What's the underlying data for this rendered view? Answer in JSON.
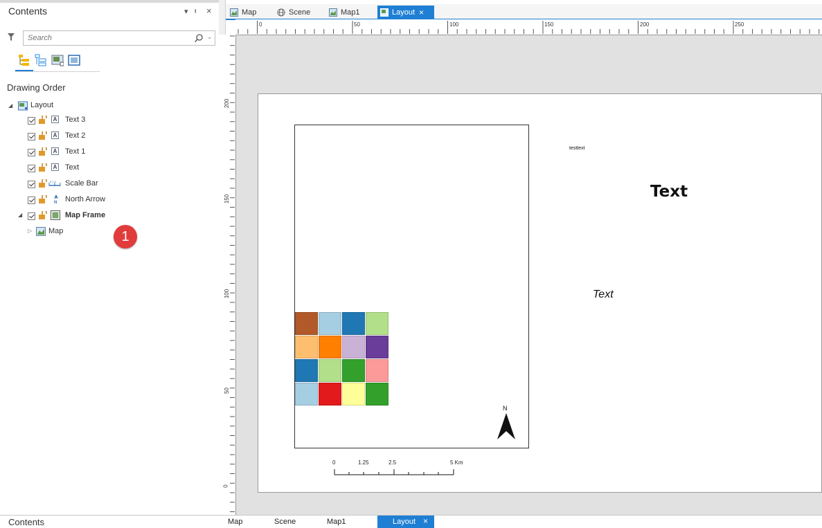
{
  "contents_pane": {
    "title": "Contents",
    "controls": [
      "▾",
      "ᵼ",
      "×"
    ],
    "search_placeholder": "Search",
    "section_title": "Drawing Order",
    "tree": {
      "root": "Layout",
      "items": [
        "Text 3",
        "Text 2",
        "Text 1",
        "Text",
        "Scale Bar",
        "North Arrow"
      ],
      "map_frame": "Map Frame",
      "map": "Map"
    }
  },
  "tabs": [
    {
      "label": "Map"
    },
    {
      "label": "Scene"
    },
    {
      "label": "Map1"
    },
    {
      "label": "Layout",
      "close": "×"
    }
  ],
  "ruler": {
    "horizontal": [
      "0",
      "50",
      "100",
      "150",
      "200",
      "250"
    ],
    "vertical": [
      "200",
      "150",
      "100",
      "50",
      "0"
    ]
  },
  "layout": {
    "small_text": "testtext",
    "big_text": "Text",
    "italic_text": "Text",
    "north_label": "N",
    "scale_labels": [
      "0",
      "1.25",
      "2.5",
      "5 Km"
    ],
    "grid_colors": [
      [
        "#b15928",
        "#a6cee3",
        "#1f78b4",
        "#b2df8a"
      ],
      [
        "#fdbf6f",
        "#ff7f00",
        "#cab2d6",
        "#6a3d9a"
      ],
      [
        "#1f78b4",
        "#b2df8a",
        "#33a02c",
        "#fb9a99"
      ],
      [
        "#a6cee3",
        "#e31a1c",
        "#ffff99",
        "#33a02c"
      ]
    ]
  },
  "badge": "1",
  "bottom_bar": {
    "title": "Contents",
    "tabs": [
      "Map",
      "Scene",
      "Map1",
      "Layout"
    ],
    "close": "×"
  },
  "colors": {
    "accent": "#1f7fd4",
    "badge": "#e23b3b",
    "canvas": "#e1e1e1"
  }
}
